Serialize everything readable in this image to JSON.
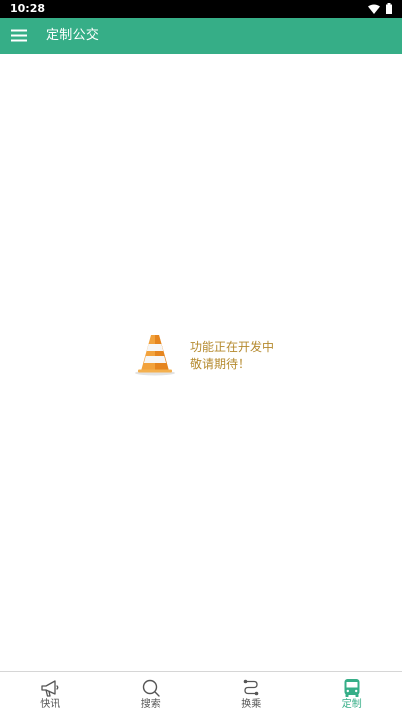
{
  "status_bar": {
    "time": "10:28",
    "icons": [
      "wifi-icon",
      "battery-icon"
    ]
  },
  "app_bar": {
    "title": "定制公交",
    "menu_icon": "hamburger-menu-icon",
    "color": "#36AE87"
  },
  "placeholder": {
    "icon": "traffic-cone-icon",
    "line1": "功能正在开发中",
    "line2": "敬请期待！",
    "text_color": "#B58A2E"
  },
  "bottom_nav": {
    "active_index": 3,
    "active_color": "#36AE87",
    "items": [
      {
        "label": "快讯",
        "icon": "megaphone-icon"
      },
      {
        "label": "搜索",
        "icon": "search-icon"
      },
      {
        "label": "换乘",
        "icon": "transfer-route-icon"
      },
      {
        "label": "定制",
        "icon": "bus-icon"
      }
    ]
  }
}
